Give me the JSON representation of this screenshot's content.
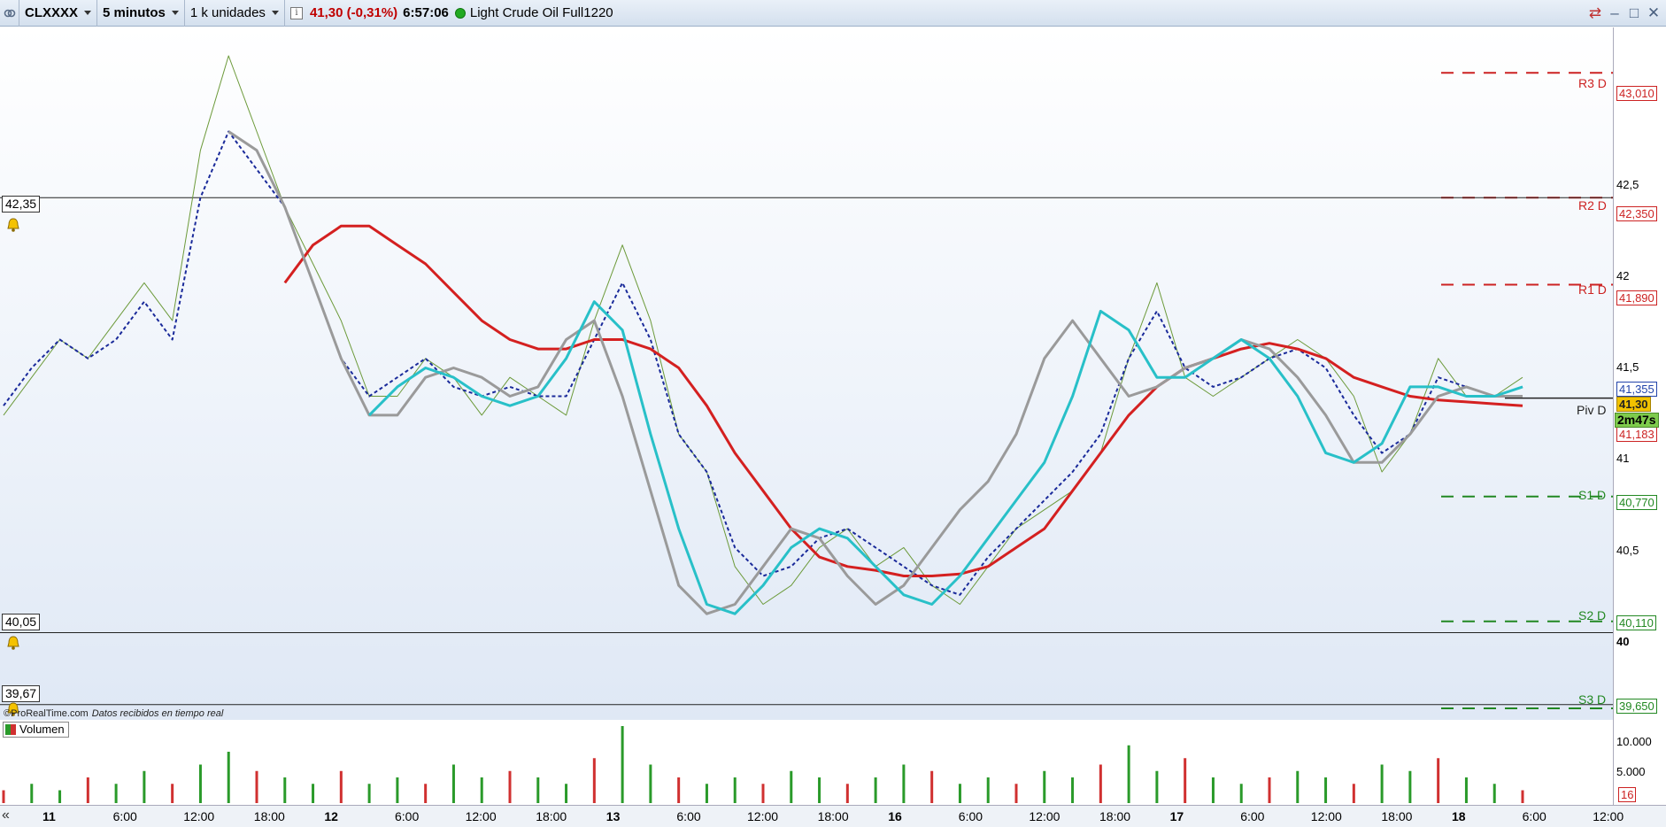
{
  "toolbar": {
    "symbol": "CLXXXX",
    "timeframe": "5 minutos",
    "units": "1 k unidades",
    "price_change": "41,30 (-0,31%)",
    "time": "6:57:06",
    "instrument_name": "Light Crude Oil Full1220",
    "link_icon": "link-chain-icon",
    "info_icon": "i",
    "status_color": "#22aa22",
    "window_controls": [
      "–",
      "□",
      "✕"
    ]
  },
  "price_axis": {
    "labels": [
      "42,5",
      "42",
      "41,5",
      "41",
      "40,5",
      "40"
    ]
  },
  "pivots": [
    {
      "name": "R3 D",
      "value": "43,010",
      "color": "#cc2222"
    },
    {
      "name": "R2 D",
      "value": "42,350",
      "color": "#cc2222"
    },
    {
      "name": "R1 D",
      "value": "41,890",
      "color": "#cc2222"
    },
    {
      "name": "Piv D",
      "value": "",
      "color": "#222222"
    },
    {
      "name": "S1 D",
      "value": "40,770",
      "color": "#228822"
    },
    {
      "name": "S2 D",
      "value": "40,110",
      "color": "#228822"
    },
    {
      "name": "S3 D",
      "value": "39,650",
      "color": "#228822"
    }
  ],
  "axis_tags": {
    "upper_partial": "41,355",
    "current_price": "41,30",
    "countdown": "2m47s",
    "lower_partial": "41,183"
  },
  "alert_lines": [
    {
      "value": "42,35"
    },
    {
      "value": "40,05"
    },
    {
      "value": "39,67"
    }
  ],
  "credit": {
    "source": "©ProRealTime.com",
    "note": "Datos recibidos en tiempo real"
  },
  "volume_panel": {
    "legend": "Volumen",
    "axis_labels": [
      "10.000",
      "5.000"
    ],
    "current": "16"
  },
  "time_axis": {
    "labels": [
      {
        "text": "11",
        "day": true
      },
      {
        "text": "6:00",
        "day": false
      },
      {
        "text": "12:00",
        "day": false
      },
      {
        "text": "18:00",
        "day": false
      },
      {
        "text": "12",
        "day": true
      },
      {
        "text": "6:00",
        "day": false
      },
      {
        "text": "12:00",
        "day": false
      },
      {
        "text": "18:00",
        "day": false
      },
      {
        "text": "13",
        "day": true
      },
      {
        "text": "6:00",
        "day": false
      },
      {
        "text": "12:00",
        "day": false
      },
      {
        "text": "18:00",
        "day": false
      },
      {
        "text": "16",
        "day": true
      },
      {
        "text": "6:00",
        "day": false
      },
      {
        "text": "12:00",
        "day": false
      },
      {
        "text": "18:00",
        "day": false
      },
      {
        "text": "17",
        "day": true
      },
      {
        "text": "6:00",
        "day": false
      },
      {
        "text": "12:00",
        "day": false
      },
      {
        "text": "18:00",
        "day": false
      },
      {
        "text": "18",
        "day": true
      },
      {
        "text": "6:00",
        "day": false
      },
      {
        "text": "12:00",
        "day": false
      }
    ],
    "nav_label": "«"
  },
  "chart_data": {
    "type": "line",
    "y_range": [
      39.65,
      43.25
    ],
    "series": [
      {
        "values": [
          41.2,
          41.4,
          41.6,
          41.5,
          41.7,
          41.9,
          41.7,
          42.6,
          43.1,
          42.7,
          42.3,
          42.0,
          41.7,
          41.3,
          41.3,
          41.5,
          41.4,
          41.2,
          41.4,
          41.3,
          41.2,
          41.7,
          42.1,
          41.7,
          41.1,
          40.9,
          40.4,
          40.2,
          40.3,
          40.5,
          40.6,
          40.4,
          40.5,
          40.3,
          40.2,
          40.4,
          40.6,
          40.7,
          40.8,
          41.0,
          41.5,
          41.9,
          41.4,
          41.3,
          41.4,
          41.5,
          41.6,
          41.5,
          41.3,
          40.9,
          41.1,
          41.5,
          41.3,
          41.3,
          41.4
        ]
      },
      {
        "values": [
          41.25,
          41.45,
          41.6,
          41.5,
          41.6,
          41.8,
          41.6,
          42.35,
          42.7,
          42.5,
          42.3,
          41.9,
          41.5,
          41.3,
          41.4,
          41.5,
          41.35,
          41.3,
          41.35,
          41.3,
          41.3,
          41.6,
          41.9,
          41.6,
          41.1,
          40.9,
          40.5,
          40.35,
          40.4,
          40.55,
          40.6,
          40.5,
          40.4,
          40.3,
          40.25,
          40.45,
          40.6,
          40.75,
          40.9,
          41.1,
          41.5,
          41.75,
          41.45,
          41.35,
          41.4,
          41.5,
          41.55,
          41.45,
          41.2,
          41.0,
          41.1,
          41.4,
          41.35,
          41.3,
          41.35
        ]
      },
      {
        "values": [
          null,
          null,
          null,
          null,
          null,
          null,
          null,
          null,
          null,
          null,
          41.9,
          42.1,
          42.2,
          42.2,
          42.1,
          42.0,
          41.85,
          41.7,
          41.6,
          41.55,
          41.55,
          41.6,
          41.6,
          41.55,
          41.45,
          41.25,
          41.0,
          40.8,
          40.6,
          40.45,
          40.4,
          40.38,
          40.35,
          40.35,
          40.36,
          40.4,
          40.5,
          40.6,
          40.8,
          41.0,
          41.2,
          41.35,
          41.45,
          41.5,
          41.55,
          41.58,
          41.55,
          41.5,
          41.4,
          41.35,
          41.3,
          41.28,
          41.27,
          41.26,
          41.25
        ]
      },
      {
        "values": [
          null,
          null,
          null,
          null,
          null,
          null,
          null,
          null,
          42.7,
          42.6,
          42.3,
          41.9,
          41.5,
          41.2,
          41.2,
          41.4,
          41.45,
          41.4,
          41.3,
          41.35,
          41.6,
          41.7,
          41.3,
          40.8,
          40.3,
          40.15,
          40.2,
          40.4,
          40.6,
          40.55,
          40.35,
          40.2,
          40.3,
          40.5,
          40.7,
          40.85,
          41.1,
          41.5,
          41.7,
          41.5,
          41.3,
          41.35,
          41.45,
          41.5,
          41.6,
          41.55,
          41.4,
          41.2,
          40.95,
          40.95,
          41.1,
          41.3,
          41.35,
          41.3,
          41.3
        ]
      },
      {
        "values": [
          null,
          null,
          null,
          null,
          null,
          null,
          null,
          null,
          null,
          null,
          null,
          null,
          null,
          41.2,
          41.35,
          41.45,
          41.4,
          41.3,
          41.25,
          41.3,
          41.5,
          41.8,
          41.65,
          41.1,
          40.6,
          40.2,
          40.15,
          40.3,
          40.5,
          40.6,
          40.55,
          40.4,
          40.25,
          40.2,
          40.35,
          40.55,
          40.75,
          40.95,
          41.3,
          41.75,
          41.65,
          41.4,
          41.4,
          41.5,
          41.6,
          41.5,
          41.3,
          41.0,
          40.95,
          41.05,
          41.35,
          41.35,
          41.3,
          41.3,
          41.35
        ]
      }
    ],
    "volume": [
      2,
      3,
      2,
      4,
      3,
      5,
      3,
      6,
      8,
      5,
      4,
      3,
      5,
      3,
      4,
      3,
      6,
      4,
      5,
      4,
      3,
      7,
      12,
      6,
      4,
      3,
      4,
      3,
      5,
      4,
      3,
      4,
      6,
      5,
      3,
      4,
      3,
      5,
      4,
      6,
      9,
      5,
      7,
      4,
      3,
      4,
      5,
      4,
      3,
      6,
      5,
      7,
      4,
      3,
      2
    ],
    "volume_ylim": [
      0,
      12000
    ]
  }
}
